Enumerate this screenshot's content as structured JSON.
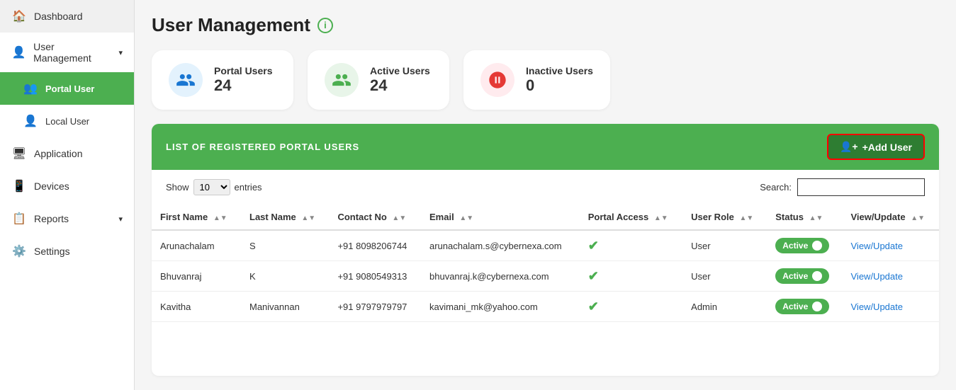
{
  "sidebar": {
    "items": [
      {
        "id": "dashboard",
        "label": "Dashboard",
        "icon": "🏠",
        "active": false
      },
      {
        "id": "user-management",
        "label": "User Management",
        "icon": "👤",
        "active": false,
        "hasChevron": true
      },
      {
        "id": "portal-user",
        "label": "Portal User",
        "icon": "👥",
        "active": true,
        "sub": true
      },
      {
        "id": "local-user",
        "label": "Local User",
        "icon": "👤",
        "active": false,
        "sub": true
      },
      {
        "id": "application",
        "label": "Application",
        "icon": "🖥",
        "active": false
      },
      {
        "id": "devices",
        "label": "Devices",
        "icon": "📱",
        "active": false
      },
      {
        "id": "reports",
        "label": "Reports",
        "icon": "📋",
        "active": false,
        "hasChevron": true
      },
      {
        "id": "settings",
        "label": "Settings",
        "icon": "⚙️",
        "active": false
      }
    ]
  },
  "page": {
    "title": "User Management",
    "info_icon": "i"
  },
  "stats": [
    {
      "id": "portal-users",
      "label": "Portal Users",
      "value": "24",
      "icon": "👤",
      "color": "blue"
    },
    {
      "id": "active-users",
      "label": "Active Users",
      "value": "24",
      "icon": "👥",
      "color": "green"
    },
    {
      "id": "inactive-users",
      "label": "Inactive Users",
      "value": "0",
      "icon": "👤",
      "color": "red"
    }
  ],
  "table": {
    "section_title": "LIST OF REGISTERED PORTAL USERS",
    "add_button": "+Add User",
    "show_label": "Show",
    "show_value": "10",
    "entries_label": "entries",
    "search_label": "Search:",
    "search_placeholder": "",
    "columns": [
      {
        "id": "first-name",
        "label": "First Name"
      },
      {
        "id": "last-name",
        "label": "Last Name"
      },
      {
        "id": "contact-no",
        "label": "Contact No"
      },
      {
        "id": "email",
        "label": "Email"
      },
      {
        "id": "portal-access",
        "label": "Portal Access"
      },
      {
        "id": "user-role",
        "label": "User Role"
      },
      {
        "id": "status",
        "label": "Status"
      },
      {
        "id": "view-update",
        "label": "View/Update"
      }
    ],
    "rows": [
      {
        "first_name": "Arunachalam",
        "last_name": "S",
        "contact_no": "+91 8098206744",
        "email": "arunachalam.s@cybernexa.com",
        "portal_access": true,
        "user_role": "User",
        "status": "Active",
        "view_update": "View/Update"
      },
      {
        "first_name": "Bhuvanraj",
        "last_name": "K",
        "contact_no": "+91 9080549313",
        "email": "bhuvanraj.k@cybernexa.com",
        "portal_access": true,
        "user_role": "User",
        "status": "Active",
        "view_update": "View/Update"
      },
      {
        "first_name": "Kavitha",
        "last_name": "Manivannan",
        "contact_no": "+91 9797979797",
        "email": "kavimani_mk@yahoo.com",
        "portal_access": true,
        "user_role": "Admin",
        "status": "Active",
        "view_update": "View/Update"
      }
    ]
  }
}
